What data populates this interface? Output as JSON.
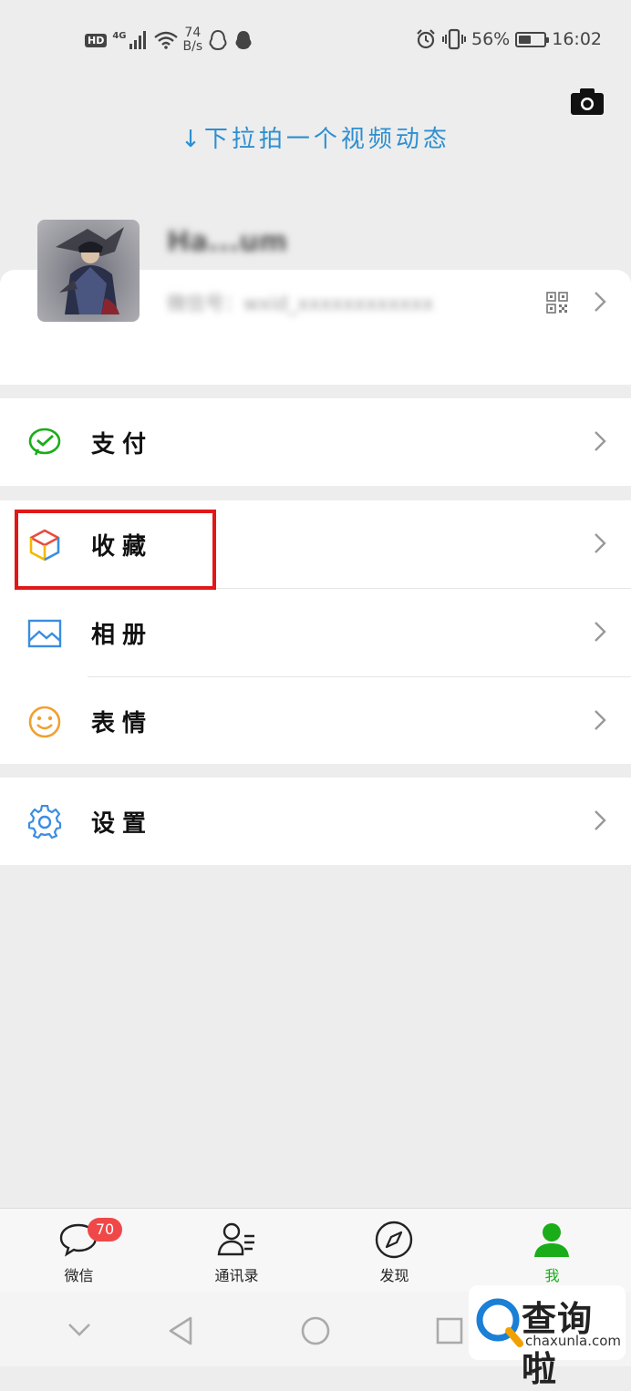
{
  "status_bar": {
    "hd": "HD",
    "network": "4G",
    "speed_value": "74",
    "speed_unit": "B/s",
    "battery_text": "56%",
    "battery_level": 0.56,
    "time": "16:02"
  },
  "header": {
    "pull_hint": "↓下拉拍一个视频动态"
  },
  "profile": {
    "nickname": "Ha...um",
    "wechat_id": "微信号：wxid_xxxxxxxxxxxx"
  },
  "menu": {
    "pay": "支付",
    "favorites": "收藏",
    "album": "相册",
    "stickers": "表情",
    "settings": "设置"
  },
  "tabs": [
    {
      "label": "微信",
      "badge": "70"
    },
    {
      "label": "通讯录"
    },
    {
      "label": "发现"
    },
    {
      "label": "我"
    }
  ],
  "colors": {
    "brand_green": "#1aad19",
    "highlight_red": "#e01818",
    "hint_blue": "#2e8fd0",
    "badge_red": "#f04848"
  },
  "watermark": {
    "name": "查询啦",
    "url": "chaxunla.com"
  }
}
